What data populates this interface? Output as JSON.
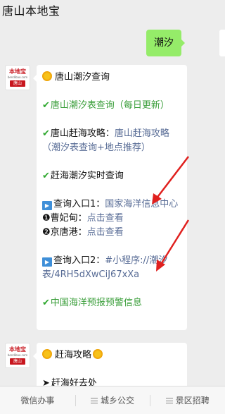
{
  "header": {
    "title": "唐山本地宝"
  },
  "outgoing": {
    "text": "潮汐"
  },
  "avatar": {
    "top": "本地宝",
    "mid": "bendibao.com",
    "bot": "唐山"
  },
  "card1": {
    "title": "唐山潮汐查询",
    "item1": "唐山潮汐表查询（每日更新）",
    "item2_label": "唐山赶海攻略：",
    "item2_link": "唐山赶海攻略（潮汐表查询+地点推荐）",
    "item3": "赶海潮汐实时查询",
    "entry1_label": "查询入口1：",
    "entry1_link": "国家海洋信息中心",
    "sub1_num": "❶",
    "sub1_label": "曹妃甸：",
    "sub1_link": "点击查看",
    "sub2_num": "❷",
    "sub2_label": "京唐港：",
    "sub2_link": "点击查看",
    "entry2_label": "查询入口2：",
    "entry2_link": "#小程序://潮汐表/4RH5dXwCiJ67xXa",
    "item4": "中国海洋预报预警信息"
  },
  "card2": {
    "title": "赶海攻略",
    "item1": "赶海好去处"
  },
  "bottom_tabs": [
    {
      "label": "微信办事",
      "has_menu": false
    },
    {
      "label": "城乡公交",
      "has_menu": true
    },
    {
      "label": "景区招聘",
      "has_menu": true
    }
  ],
  "colors": {
    "link": "#576b95",
    "bubble_out": "#95ec69",
    "accent_red": "#e0201e",
    "check_green": "#2fa82f"
  },
  "icons": [
    "sun-icon",
    "check-icon",
    "play-icon",
    "menu-icon",
    "arrow-right-icon"
  ]
}
